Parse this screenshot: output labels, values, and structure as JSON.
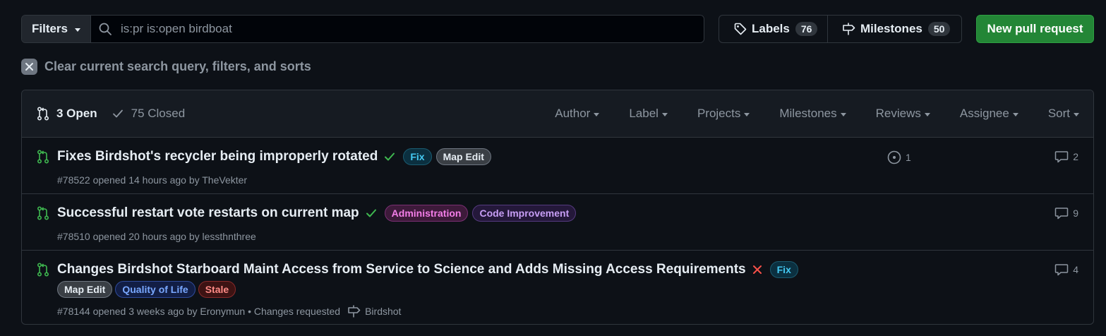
{
  "toolbar": {
    "filters_label": "Filters",
    "search_value": "is:pr is:open birdboat",
    "labels_label": "Labels",
    "labels_count": "76",
    "milestones_label": "Milestones",
    "milestones_count": "50",
    "new_pr_label": "New pull request"
  },
  "clear": {
    "text": "Clear current search query, filters, and sorts"
  },
  "header": {
    "open_label": "3 Open",
    "closed_label": "75 Closed",
    "filters": [
      "Author",
      "Label",
      "Projects",
      "Milestones",
      "Reviews",
      "Assignee",
      "Sort"
    ]
  },
  "pull_requests": [
    {
      "title": "Fixes Birdshot's recycler being improperly rotated",
      "status": "success",
      "labels": [
        "Fix",
        "Map Edit"
      ],
      "meta": "#78522 opened 14 hours ago by TheVekter",
      "linked_issues": "1",
      "comments": "2"
    },
    {
      "title": "Successful restart vote restarts on current map",
      "status": "success",
      "labels": [
        "Administration",
        "Code Improvement"
      ],
      "meta": "#78510 opened 20 hours ago by lessthnthree",
      "comments": "9"
    },
    {
      "title": "Changes Birdshot Starboard Maint Access from Service to Science and Adds Missing Access Requirements",
      "status": "failure",
      "labels_inline": [
        "Fix"
      ],
      "labels": [
        "Map Edit",
        "Quality of Life",
        "Stale"
      ],
      "meta": "#78144 opened 3 weeks ago by Eronymun • Changes requested",
      "milestone": "Birdshot",
      "comments": "4"
    }
  ],
  "colors": {
    "background": "#0d1117",
    "open_green": "#3fb950",
    "primary_button": "#238636",
    "failure_red": "#f85149"
  }
}
